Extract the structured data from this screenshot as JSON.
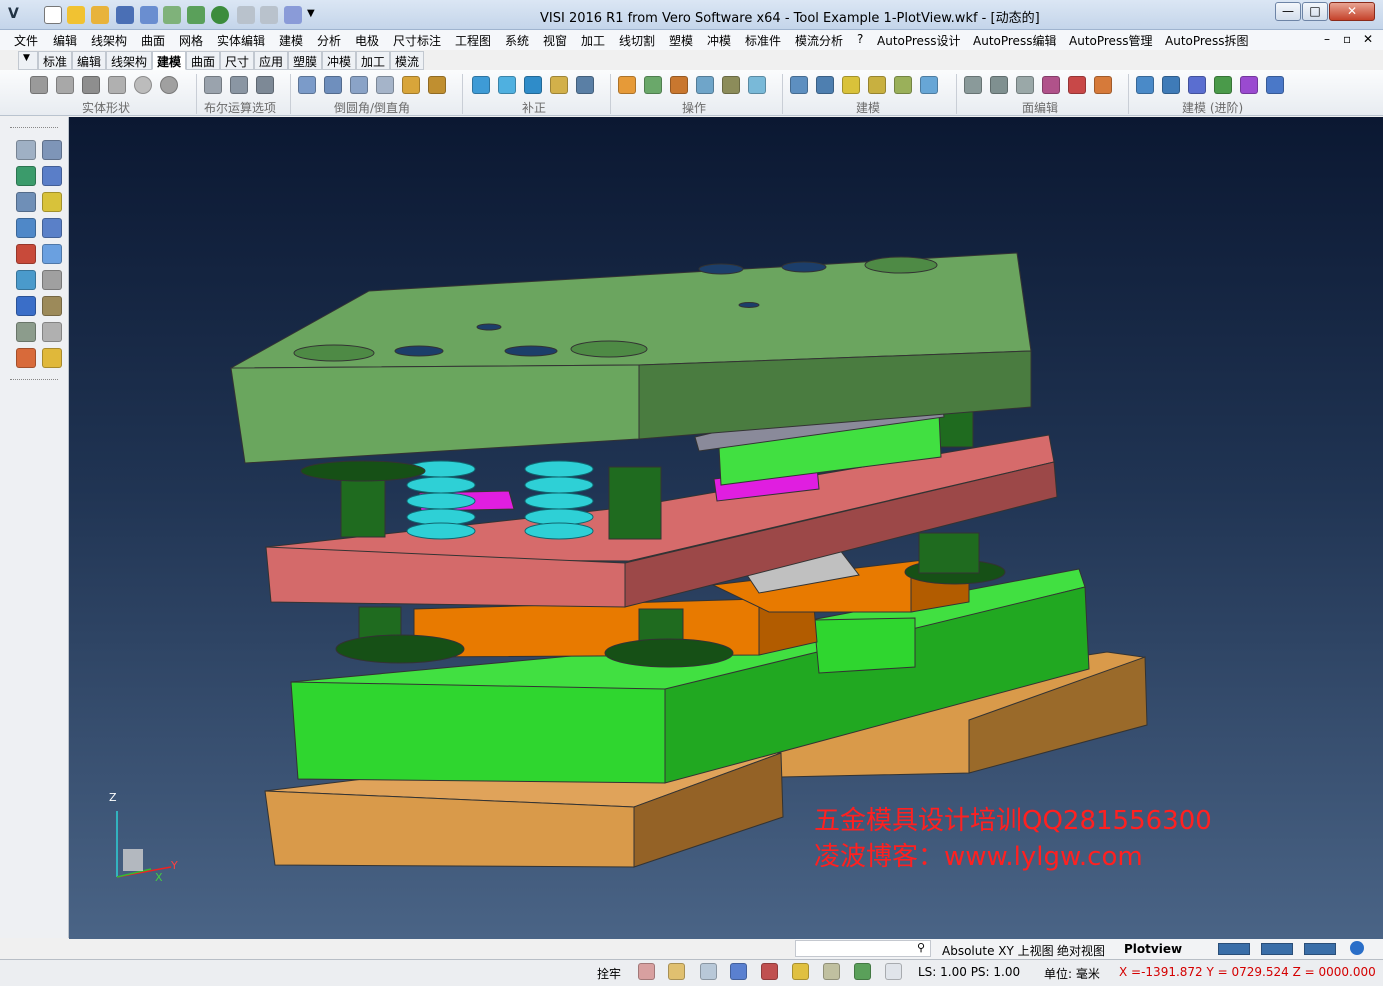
{
  "window": {
    "title": "VISI 2016 R1 from Vero Software x64 - Tool Example 1-PlotView.wkf - [动态的]",
    "app_logo": "V",
    "buttons": {
      "minimize": "—",
      "maximize": "□",
      "close": "✕"
    }
  },
  "menu": {
    "items": [
      "文件",
      "编辑",
      "线架构",
      "曲面",
      "网格",
      "实体编辑",
      "建模",
      "分析",
      "电极",
      "尺寸标注",
      "工程图",
      "系统",
      "视窗",
      "加工",
      "线切割",
      "塑模",
      "冲模",
      "标准件",
      "模流分析",
      "?",
      "AutoPress设计",
      "AutoPress编辑",
      "AutoPress管理",
      "AutoPress拆图"
    ],
    "doc_controls": [
      "–",
      "▫",
      "✕"
    ]
  },
  "tabs": {
    "items": [
      "标准",
      "编辑",
      "线架构",
      "建模",
      "曲面",
      "尺寸",
      "应用",
      "塑膜",
      "冲模",
      "加工",
      "模流"
    ],
    "active": "建模"
  },
  "ribbon": {
    "groups": [
      "实体形状",
      "布尔运算选项",
      "倒圆角/倒直角",
      "补正",
      "操作",
      "建模",
      "面编辑",
      "建模 (进阶)"
    ]
  },
  "viewport": {
    "watermark_line1": "五金模具设计培训QQ281556300",
    "watermark_line2": "凌波博客：www.lylgw.com",
    "axis_z": "Z",
    "axis_y": "Y",
    "axis_x": "X"
  },
  "viewbar": {
    "items": [
      "Absolute XY 上视图",
      "绝对视图",
      "Plotview"
    ]
  },
  "status": {
    "mode": "拴牢",
    "ls_ps": "LS: 1.00 PS: 1.00",
    "unit": "单位: 毫米",
    "coords": "X =-1391.872 Y = 0729.524 Z = 0000.000"
  },
  "colors": {
    "viewport_top": "#0b1832",
    "viewport_bottom": "#4a6486",
    "watermark": "#ff2020",
    "top_plate": "#6aa65e",
    "stripper": "#d66b6b",
    "die_plate": "#2fd62f",
    "base_plate": "#d99a4a",
    "spring": "#2ed0d6",
    "pin": "#1f6b1f",
    "insert": "#e87a00",
    "punch": "#e01ee0"
  }
}
